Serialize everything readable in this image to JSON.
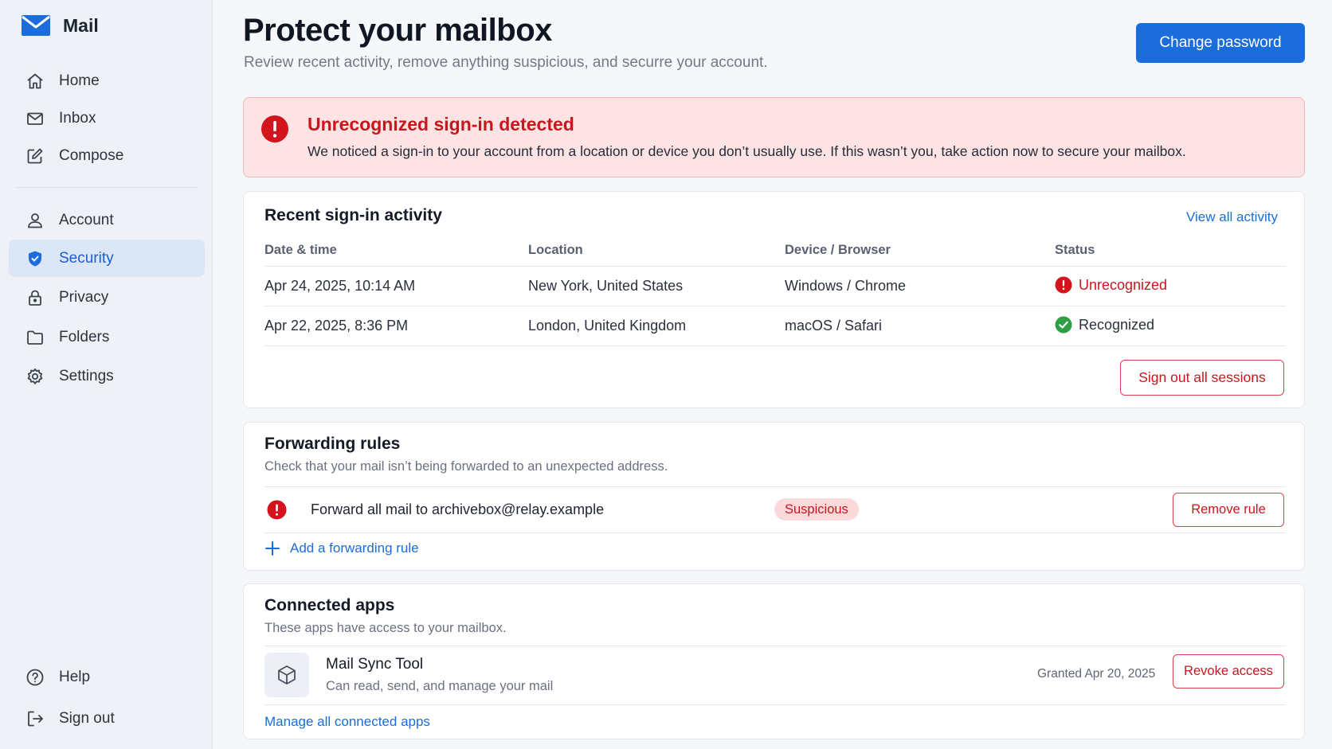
{
  "app": {
    "name": "Mail"
  },
  "sidebar": {
    "items": [
      {
        "label": "Home",
        "icon": "home-icon"
      },
      {
        "label": "Inbox",
        "icon": "inbox-icon"
      },
      {
        "label": "Compose",
        "icon": "compose-icon"
      },
      {
        "label": "Account",
        "icon": "user-icon"
      },
      {
        "label": "Security",
        "icon": "shield-icon",
        "active": true
      },
      {
        "label": "Privacy",
        "icon": "lock-icon"
      },
      {
        "label": "Folders",
        "icon": "folder-icon"
      },
      {
        "label": "Settings",
        "icon": "gear-icon"
      }
    ],
    "bottom_items": [
      {
        "label": "Help",
        "icon": "help-icon"
      },
      {
        "label": "Sign out",
        "icon": "sign-out-icon"
      }
    ]
  },
  "header": {
    "title": "Protect your mailbox",
    "subtitle": "Review recent activity, remove anything suspicious, and securre your account.",
    "change_password_label": "Change password"
  },
  "alert": {
    "title": "Unrecognized sign-in detected",
    "message": "We noticed a sign-in to your account from a location or device you don’t usually use. If this wasn’t you, take action now to secure your mailbox."
  },
  "signin_activity": {
    "title": "Recent sign-in activity",
    "view_all_label": "View all activity",
    "columns": [
      "Date & time",
      "Location",
      "Device / Browser",
      "Status"
    ],
    "rows": [
      {
        "datetime": "Apr 24, 2025, 10:14 AM",
        "location": "New York, United States",
        "device": "Windows / Chrome",
        "status": "Unrecognized"
      },
      {
        "datetime": "Apr 22, 2025, 8:36 PM",
        "location": "London, United Kingdom",
        "device": "macOS / Safari",
        "status": "Recognized"
      }
    ],
    "sign_out_all_label": "Sign out all sessions"
  },
  "forwarding": {
    "title": "Forwarding rules",
    "description": "Check that your mail isn’t being forwarded to an unexpected address.",
    "rule": {
      "text": "Forward all mail to archivebox@relay.example",
      "badge": "Suspicious",
      "remove_label": "Remove rule"
    },
    "add_label": "Add a forwarding rule"
  },
  "connected_apps": {
    "title": "Connected apps",
    "description": "These apps have access to your mailbox.",
    "app": {
      "name": "Mail Sync Tool",
      "permission": "Can read, send, and manage your mail",
      "granted": "Granted Apr 20, 2025",
      "revoke_label": "Revoke access"
    },
    "manage_label": "Manage all connected apps"
  },
  "colors": {
    "accent": "#1a6ddb",
    "danger": "#c8161d",
    "success": "#2ea043",
    "alert_bg": "#fde3e4",
    "active_nav_bg": "#dbe6f7"
  }
}
